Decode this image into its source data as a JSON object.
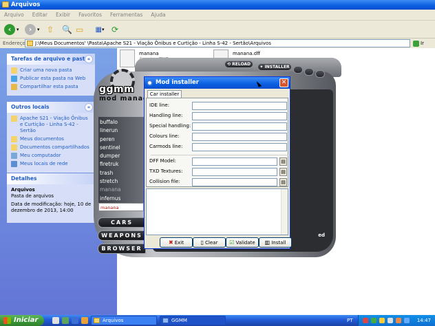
{
  "window": {
    "title": "Arquivos"
  },
  "menu": [
    "Arquivo",
    "Editar",
    "Exibir",
    "Favoritos",
    "Ferramentas",
    "Ajuda"
  ],
  "address": {
    "label": "Endereço",
    "path": "J:\\Meus Documentos'            \\Pasta\\Apache S21 - Viação Ônibus e Curtição - Linha S-42 - Sertão\\Arquivos",
    "go": "Ir"
  },
  "tasks": {
    "title": "Tarefas de arquivo e pasta",
    "items": [
      "Criar uma nova pasta",
      "Publicar esta pasta na Web",
      "Compartilhar esta pasta"
    ]
  },
  "places": {
    "title": "Outros locais",
    "items": [
      "Apache S21 - Viação Ônibus e Curtição - Linha S-42 - Sertão",
      "Meus documentos",
      "Documentos compartilhados",
      "Meu computador",
      "Meus locais de rede"
    ]
  },
  "details": {
    "title": "Detalhes",
    "name": "Arquivos",
    "type": "Pasta de arquivos",
    "modified": "Data de modificação: hoje, 10 de dezembro de 2013, 14:00"
  },
  "files": [
    {
      "name": "manana",
      "type": "Arquivo TXD"
    },
    {
      "name": "manana.dff",
      "type": ""
    }
  ],
  "ggmm": {
    "logo_top": "ggmm",
    "logo_bottom": "mod manager",
    "reload": "RELOAD",
    "install": "INSTALLER",
    "vehicles": [
      "buffalo",
      "linerun",
      "peren",
      "sentinel",
      "dumper",
      "firetruk",
      "trash",
      "stretch",
      "manana",
      "infernus",
      "manana"
    ],
    "categories": [
      "CARS",
      "WEAPONS",
      "BROWSER"
    ]
  },
  "dialog": {
    "title": "Mod installer",
    "tab": "Car installer",
    "fields": [
      {
        "label": "IDE line:",
        "value": ""
      },
      {
        "label": "Handling line:",
        "value": ""
      },
      {
        "label": "Special handling:",
        "value": ""
      },
      {
        "label": "Colours line:",
        "value": ""
      },
      {
        "label": "Carmods line:",
        "value": ""
      }
    ],
    "files": [
      {
        "label": "DFF Model:",
        "value": ""
      },
      {
        "label": "TXD Textures:",
        "value": ""
      },
      {
        "label": "Collision file:",
        "value": ""
      }
    ],
    "buttons": {
      "exit": "Exit",
      "clear": "Clear",
      "validate": "Validate",
      "install": "Install"
    }
  },
  "taskbar": {
    "start": "Iniciar",
    "windows": [
      "Arquivos",
      "GGMM"
    ],
    "lang": "PT",
    "clock": "14:47"
  }
}
